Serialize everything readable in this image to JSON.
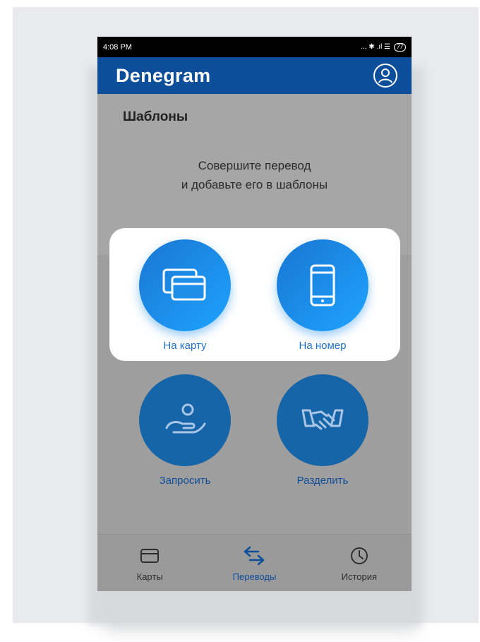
{
  "status_bar": {
    "time": "4:08 PM",
    "indicators": "... ✱ .ıl ☰",
    "battery": "77"
  },
  "app": {
    "brand": "Denegram",
    "profile_icon": "user-circle-icon"
  },
  "templates": {
    "title": "Шаблоны",
    "hint_line1": "Совершите перевод",
    "hint_line2": "и добавьте его в шаблоны"
  },
  "actions": {
    "to_card": "На карту",
    "to_number": "На номер",
    "request": "Запросить",
    "split": "Разделить"
  },
  "nav": {
    "cards": "Карты",
    "transfers": "Переводы",
    "history": "История"
  },
  "colors": {
    "brand": "#0d4e9a",
    "accent": "#1e8ee8",
    "dimmed": "#9e9e9e"
  }
}
